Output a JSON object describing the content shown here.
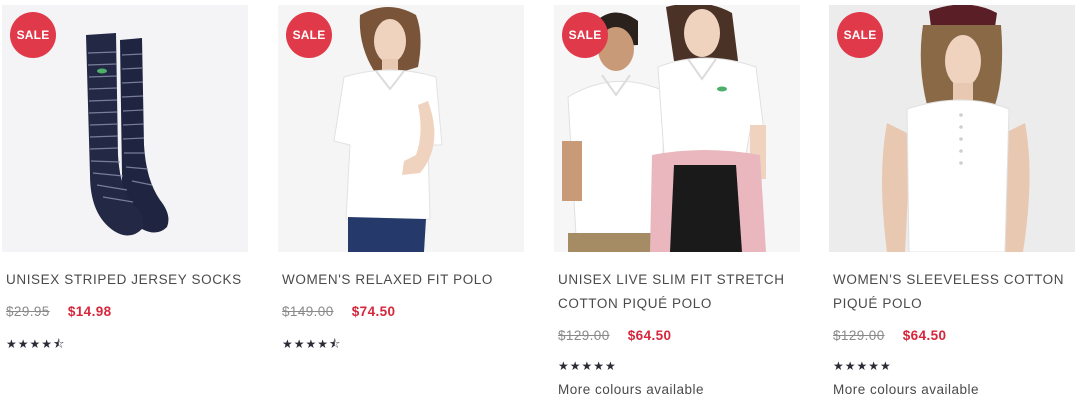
{
  "products": [
    {
      "badge": "SALE",
      "name_lines": [
        "UNISEX STRIPED JERSEY SOCKS"
      ],
      "old_price": "$29.95",
      "new_price": "$14.98",
      "rating": 4.5,
      "stars": "★★★★⯪",
      "extra": ""
    },
    {
      "badge": "SALE",
      "name_lines": [
        "WOMEN'S RELAXED FIT POLO"
      ],
      "old_price": "$149.00",
      "new_price": "$74.50",
      "rating": 4.5,
      "stars": "★★★★⯪",
      "extra": ""
    },
    {
      "badge": "SALE",
      "name_lines": [
        "UNISEX LIVE SLIM FIT STRETCH",
        "COTTON PIQUÉ POLO"
      ],
      "old_price": "$129.00",
      "new_price": "$64.50",
      "rating": 5,
      "stars": "★★★★★",
      "extra": "More colours available"
    },
    {
      "badge": "SALE",
      "name_lines": [
        "WOMEN'S SLEEVELESS COTTON",
        "PIQUÉ POLO"
      ],
      "old_price": "$129.00",
      "new_price": "$64.50",
      "rating": 5,
      "stars": "★★★★★",
      "extra": "More colours available"
    }
  ],
  "colors": {
    "sale_badge": "#e03a4a",
    "sale_price": "#d6263b",
    "old_price": "#8a8a8a",
    "text": "#4a4a4a",
    "stars": "#2b2b36"
  }
}
